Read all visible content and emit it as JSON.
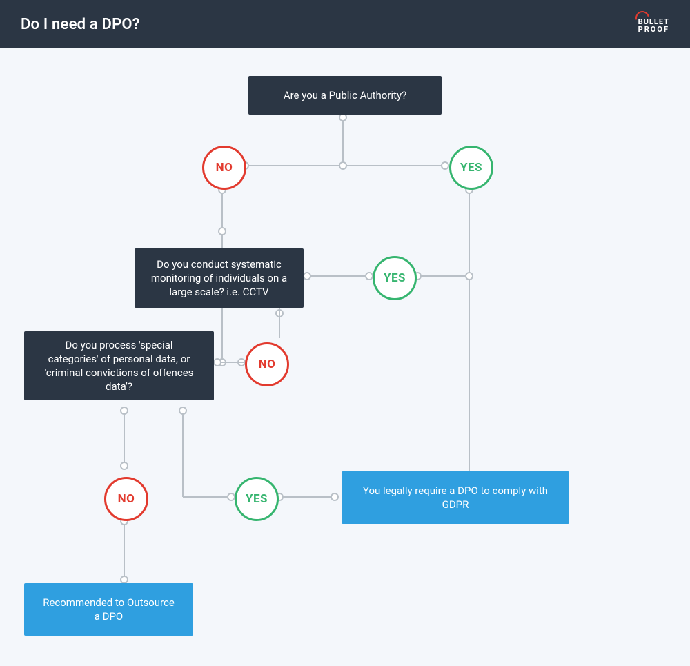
{
  "header": {
    "title": "Do I need a DPO?",
    "logo_line1": "BULLET",
    "logo_line2": "PROOF"
  },
  "nodes": {
    "q1": "Are you a Public Authority?",
    "q2": "Do you conduct systematic monitoring of individuals on a large scale? i.e. CCTV",
    "q3": "Do you process 'special categories' of personal data, or 'criminal convictions of offences data'?",
    "legal": "You legally require a DPO to comply with GDPR",
    "recommend": "Recommended to Outsource a DPO"
  },
  "labels": {
    "no": "NO",
    "yes": "YES"
  }
}
